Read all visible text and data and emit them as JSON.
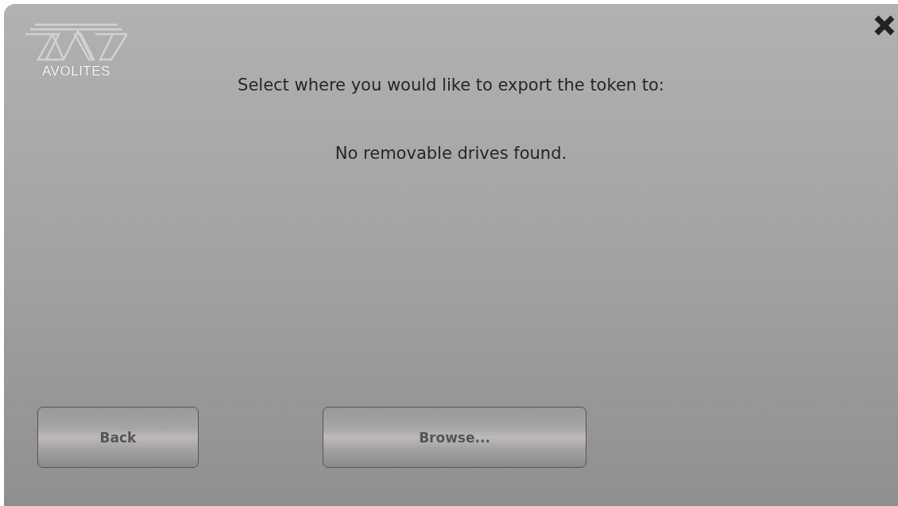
{
  "logo": {
    "text": "AVOLITES"
  },
  "title": "Select where you would like to export the token to:",
  "message": "No removable drives found.",
  "buttons": [
    {
      "label": "Back",
      "kind": "narrow"
    },
    {
      "label": "Browse...",
      "kind": "wide"
    }
  ]
}
